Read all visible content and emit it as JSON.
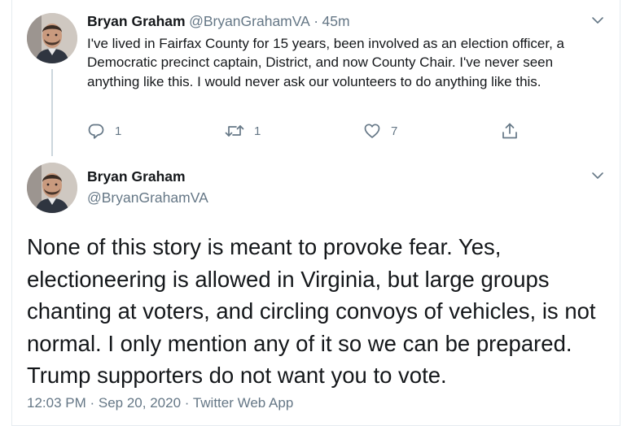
{
  "reply": {
    "author_name": "Bryan Graham",
    "author_handle": "@BryanGrahamVA",
    "separator": "·",
    "time_ago": "45m",
    "text": "I've lived in Fairfax County for 15 years, been involved as an election officer, a Democratic precinct captain, District, and now County Chair. I've never seen anything like this. I would never ask our volunteers to do anything like this.",
    "reply_count": "1",
    "retweet_count": "1",
    "like_count": "7"
  },
  "main_tweet": {
    "author_name": "Bryan Graham",
    "author_handle": "@BryanGrahamVA",
    "text": "None of this story is meant to provoke fear. Yes, electioneering is allowed in Virginia, but large groups chanting at voters, and circling convoys of vehicles, is not normal. I only mention any of it so we can be prepared. Trump supporters do not want you to vote.",
    "meta": "12:03 PM · Sep 20, 2020 · Twitter Web App"
  },
  "icons": {
    "reply": "reply-icon",
    "retweet": "retweet-icon",
    "like": "heart-icon",
    "share": "share-icon",
    "more": "chevron-down-icon"
  },
  "colors": {
    "text": "#14171a",
    "secondary": "#657786",
    "thread_line": "#ccd6dd"
  }
}
